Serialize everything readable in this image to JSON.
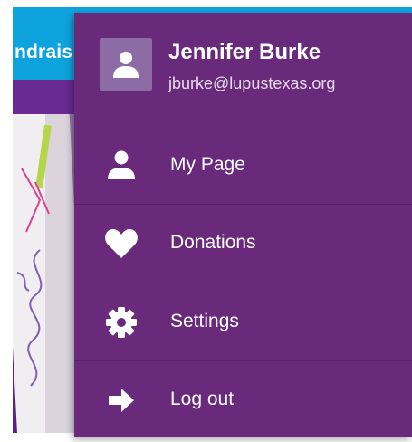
{
  "background": {
    "header_text": "ndrais"
  },
  "user": {
    "name": "Jennifer Burke",
    "email": "jburke@lupustexas.org",
    "avatar_icon": "person-icon"
  },
  "menu": {
    "items": [
      {
        "label": "My Page",
        "icon": "person-icon"
      },
      {
        "label": "Donations",
        "icon": "heart-icon"
      },
      {
        "label": "Settings",
        "icon": "gear-icon"
      },
      {
        "label": "Log out",
        "icon": "arrow-right-icon"
      }
    ]
  },
  "colors": {
    "menu_bg": "#6a2a7c",
    "header_bg": "#0fa3dd",
    "avatar_bg": "#8d6ba4",
    "text": "#ffffff"
  }
}
